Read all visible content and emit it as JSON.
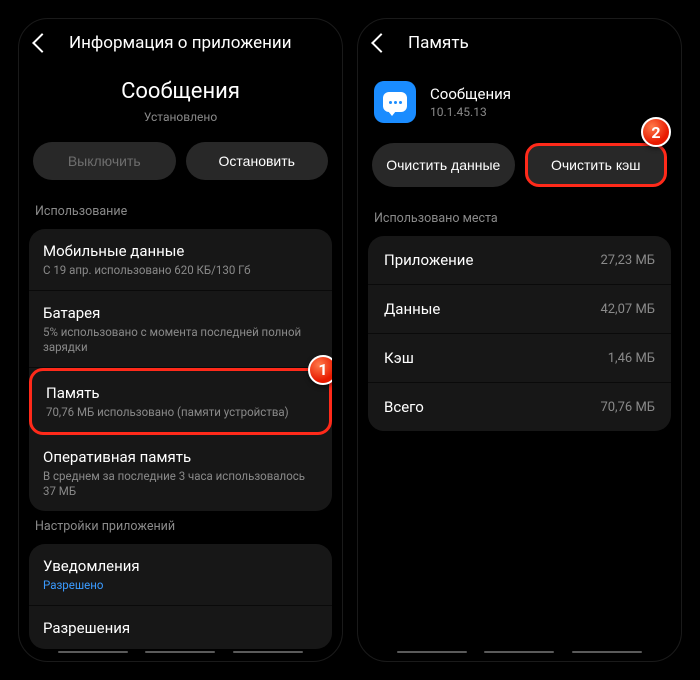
{
  "left": {
    "header_title": "Информация о приложении",
    "app_title": "Сообщения",
    "app_status": "Установлено",
    "btn_disable": "Выключить",
    "btn_stop": "Остановить",
    "section_usage": "Использование",
    "mobile_data": {
      "title": "Мобильные данные",
      "sub": "С 19 апр. использовано 620 КБ/130 Гб"
    },
    "battery": {
      "title": "Батарея",
      "sub": "5% использовано с момента последней полной зарядки"
    },
    "storage_item": {
      "title": "Память",
      "sub": "70,76 МБ использовано (памяти устройства)"
    },
    "ram": {
      "title": "Оперативная память",
      "sub": "В среднем за последние 3 часа использовалось 37 МБ"
    },
    "section_app_settings": "Настройки приложений",
    "notifications": {
      "title": "Уведомления",
      "sub": "Разрешено"
    },
    "permissions": {
      "title": "Разрешения"
    },
    "badge1": "1"
  },
  "right": {
    "header_title": "Память",
    "app_name": "Сообщения",
    "app_version": "10.1.45.13",
    "btn_clear_data": "Очистить данные",
    "btn_clear_cache": "Очистить кэш",
    "section_space": "Использовано места",
    "rows": {
      "app": {
        "k": "Приложение",
        "v": "27,23 МБ"
      },
      "data": {
        "k": "Данные",
        "v": "42,07 МБ"
      },
      "cache": {
        "k": "Кэш",
        "v": "1,46 МБ"
      },
      "total": {
        "k": "Всего",
        "v": "70,76 МБ"
      }
    },
    "badge2": "2"
  }
}
